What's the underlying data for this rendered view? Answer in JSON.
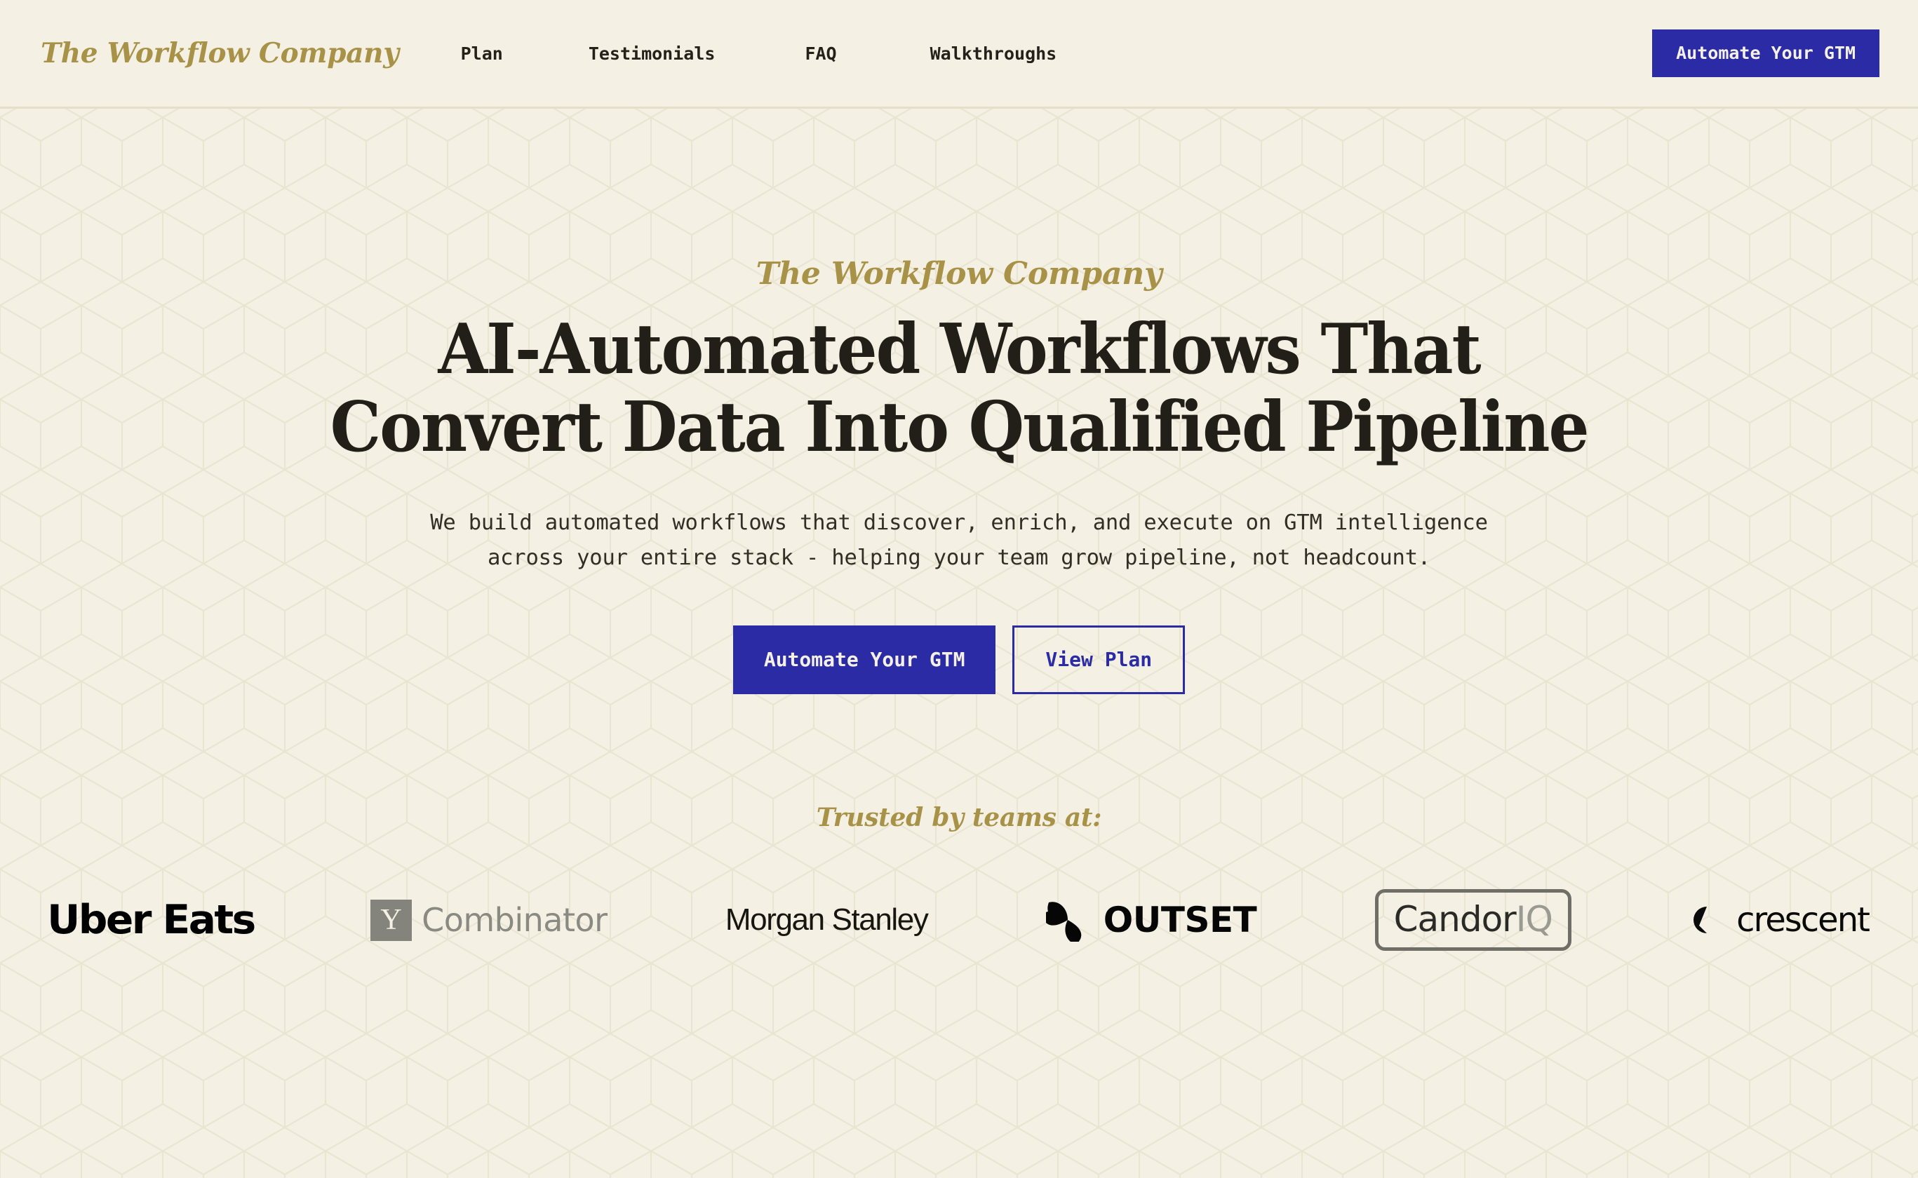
{
  "theme": {
    "background": "#F4F1E4",
    "accent_blue": "#2B2BA6",
    "accent_gold": "#A89247",
    "ink": "#24211A",
    "hairline": "#E5DFC9",
    "pattern_line": "#EBE7D6"
  },
  "header": {
    "brand": "The Workflow Company",
    "nav": [
      {
        "label": "Plan"
      },
      {
        "label": "Testimonials"
      },
      {
        "label": "FAQ"
      },
      {
        "label": "Walkthroughs"
      }
    ],
    "cta_label": "Automate Your GTM"
  },
  "hero": {
    "eyebrow": "The Workflow Company",
    "headline_line_1": "AI-Automated Workflows That",
    "headline_line_2": "Convert Data Into Qualified Pipeline",
    "subtitle_line_1": "We build automated workflows that discover, enrich, and execute on GTM intelligence",
    "subtitle_line_2": "across your entire stack - helping your team grow pipeline, not headcount.",
    "primary_cta": "Automate Your GTM",
    "secondary_cta": "View Plan"
  },
  "trusted": {
    "label": "Trusted by teams at:",
    "logos": [
      {
        "name": "uber-eats",
        "text": "Uber Eats"
      },
      {
        "name": "y-combinator",
        "mark": "Y",
        "text": "Combinator"
      },
      {
        "name": "morgan-stanley",
        "text": "Morgan Stanley"
      },
      {
        "name": "outset",
        "text": "OUTSET"
      },
      {
        "name": "candoriq",
        "text_primary": "Candor",
        "text_secondary": "IQ"
      },
      {
        "name": "crescent",
        "text": "crescent"
      }
    ]
  }
}
